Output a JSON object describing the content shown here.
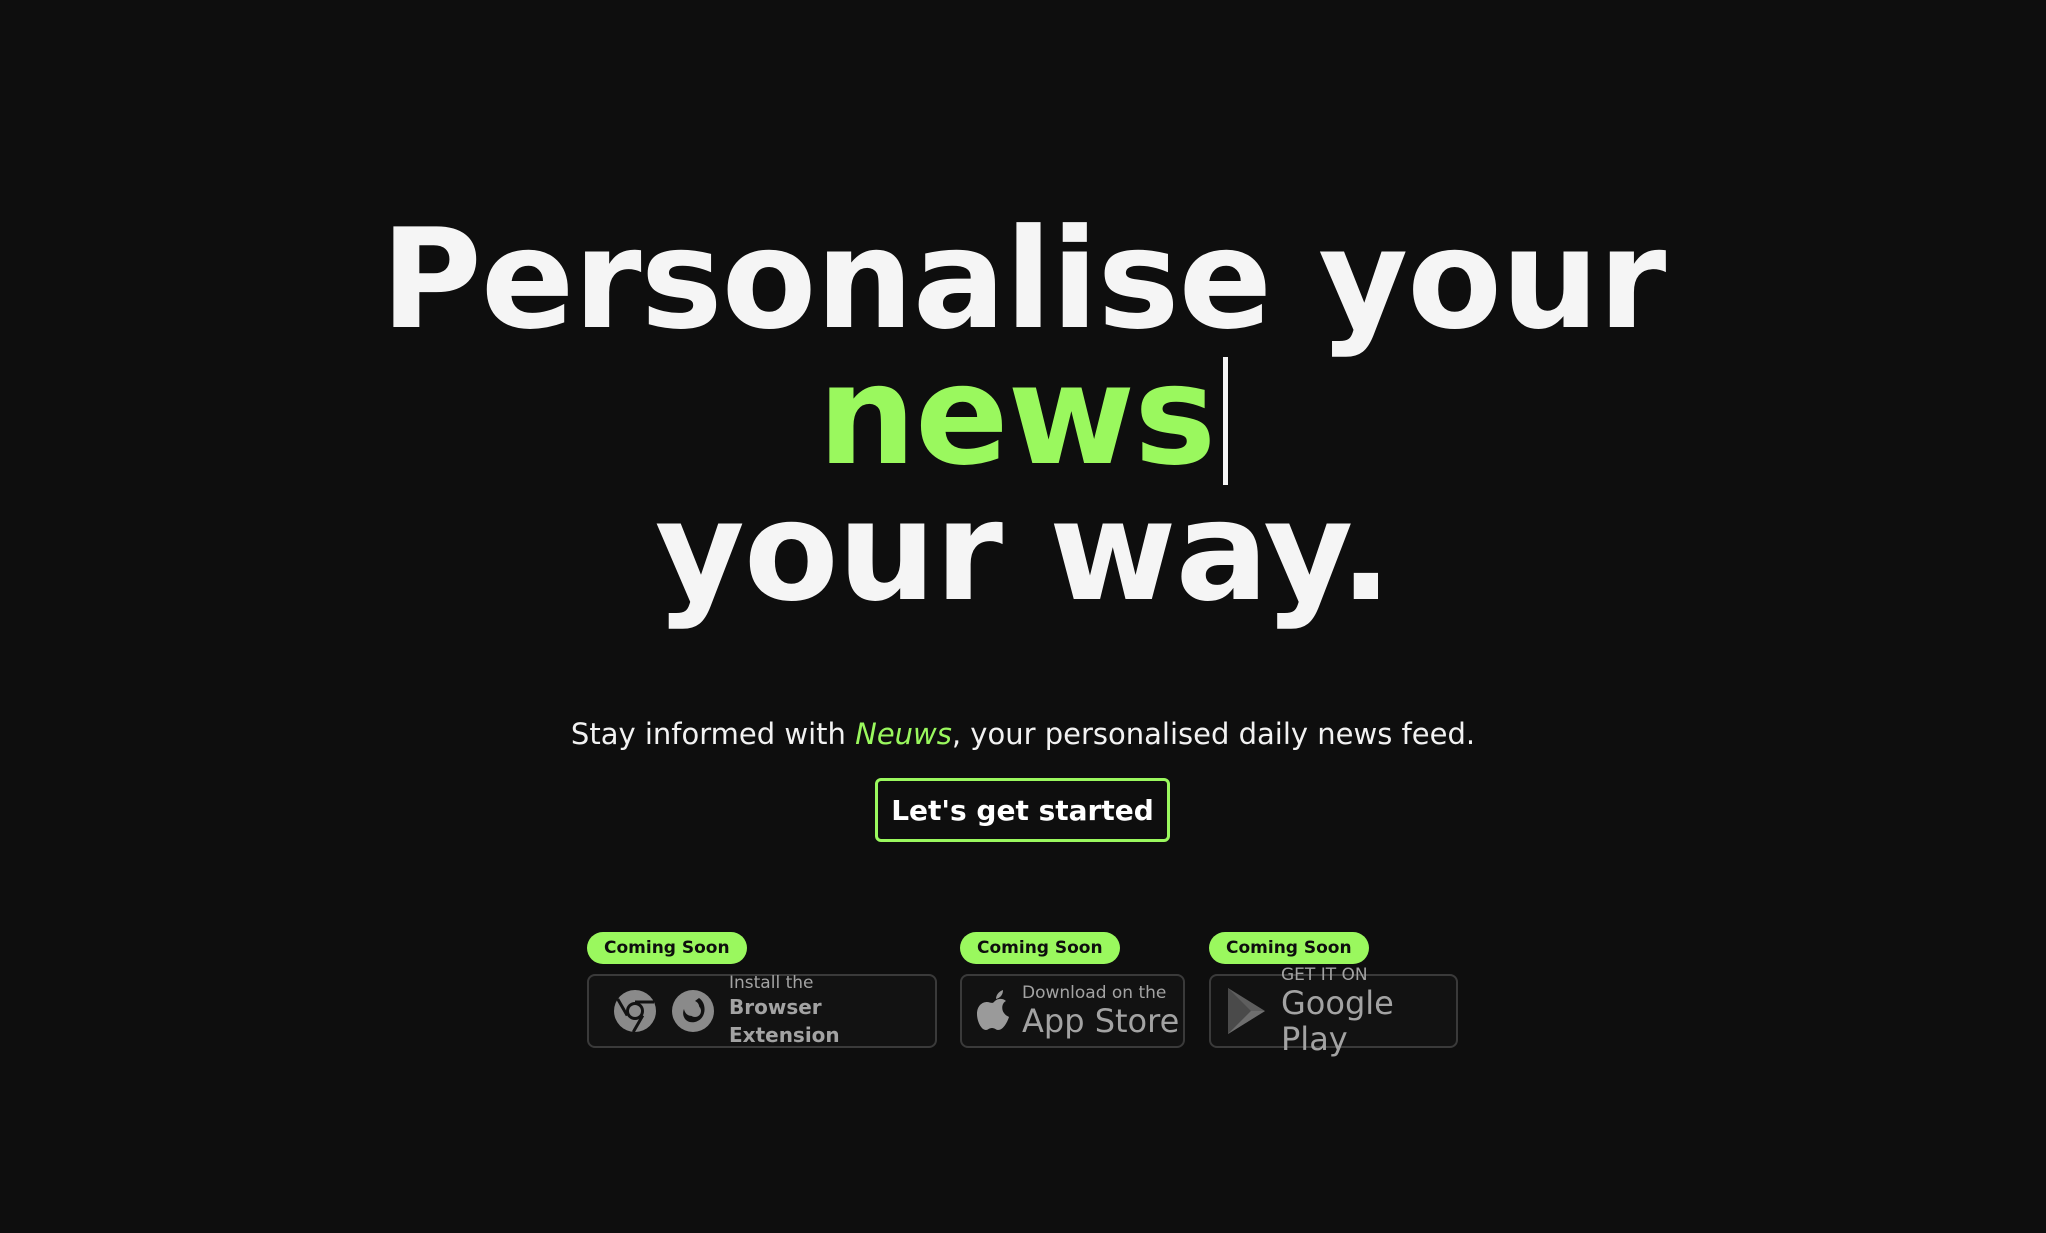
{
  "hero": {
    "line1": "Personalise your",
    "line2_word": "news",
    "line3": "your way.",
    "accent_color": "#9af85e",
    "background_color": "#0e0e0e"
  },
  "tagline": {
    "before": "Stay informed with ",
    "brand": "Neuws",
    "after": ", your personalised daily news feed."
  },
  "cta": {
    "label": "Let's get started"
  },
  "stores": {
    "extension": {
      "badge": "Coming Soon",
      "small": "Install the",
      "big": "Browser Extension",
      "icons": [
        "chrome-icon",
        "firefox-icon"
      ]
    },
    "app_store": {
      "badge": "Coming Soon",
      "small": "Download on the",
      "big": "App Store",
      "icon": "apple-icon"
    },
    "google_play": {
      "badge": "Coming Soon",
      "small": "GET IT ON",
      "big": "Google Play",
      "icon": "google-play-icon"
    }
  }
}
